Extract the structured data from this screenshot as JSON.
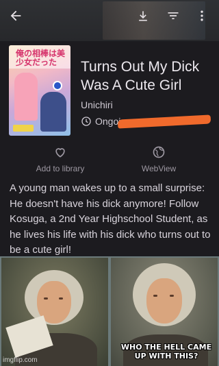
{
  "manga": {
    "title": "Turns Out My Dick Was A Cute Girl",
    "author": "Unichiri",
    "status": "Ongoing",
    "cover_art_text": "俺の相棒は美少女だった",
    "description": "A young man wakes up to a small surprise: He doesn't have his dick anymore! Follow Kosuga, a 2nd Year Highschool Student, as he lives his life with his dick who turns out to be a cute girl!"
  },
  "actions": {
    "add_library": "Add to library",
    "webview": "WebView"
  },
  "icons": {
    "back": "arrow-back-icon",
    "download": "download-icon",
    "filter": "filter-icon",
    "more": "more-vert-icon",
    "status": "clock-icon",
    "library": "heart-outline-icon",
    "webview": "globe-icon"
  },
  "colors": {
    "background": "#1c1b1f",
    "redaction": "#f06a2c"
  },
  "meme": {
    "caption": "WHO THE HELL CAME UP WITH THIS?",
    "watermark": "imgflip.com"
  }
}
